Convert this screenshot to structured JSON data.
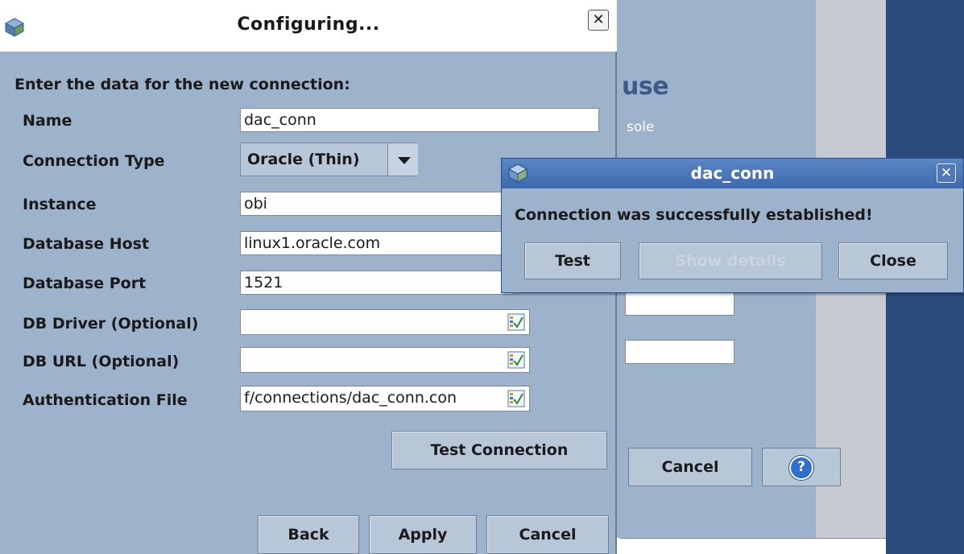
{
  "background_window": {
    "heading_fragment": "use",
    "subheading_fragment": "sole",
    "cancel_label": "Cancel",
    "help_icon": "question-circle-icon",
    "help_glyph": "?"
  },
  "dialog": {
    "title": "Configuring...",
    "close_glyph": "✕",
    "prompt": "Enter the data for the new connection:",
    "fields": {
      "name": {
        "label": "Name",
        "value": "dac_conn"
      },
      "connection_type": {
        "label": "Connection Type",
        "value": "Oracle (Thin)"
      },
      "instance": {
        "label": "Instance",
        "value": "obi"
      },
      "db_host": {
        "label": "Database Host",
        "value": "linux1.oracle.com"
      },
      "db_port": {
        "label": "Database Port",
        "value": "1521"
      },
      "db_driver": {
        "label": "DB Driver (Optional)",
        "value": ""
      },
      "db_url": {
        "label": "DB URL (Optional)",
        "value": ""
      },
      "auth_file": {
        "label": "Authentication File",
        "value": "f/connections/dac_conn.con"
      }
    },
    "test_connection_label": "Test Connection",
    "back_label": "Back",
    "apply_label": "Apply",
    "cancel_label": "Cancel"
  },
  "popup": {
    "title": "dac_conn",
    "close_glyph": "✕",
    "message": "Connection was successfully established!",
    "test_label": "Test",
    "show_details_label": "Show details",
    "close_label": "Close"
  },
  "colors": {
    "dialog_bg": "#9db3cc",
    "popup_title_bg": "#4a75b7",
    "desktop_bg": "#2d4a7e"
  }
}
